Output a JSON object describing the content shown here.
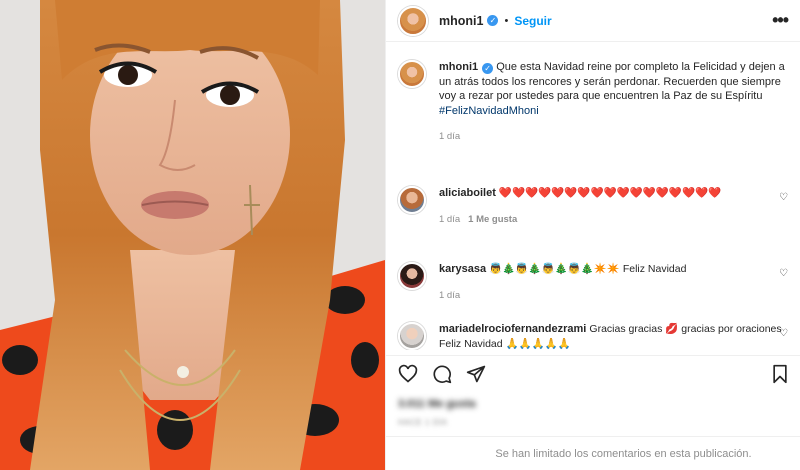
{
  "photo": {
    "alt_subject": "woman-portrait"
  },
  "header": {
    "username": "mhoni1",
    "follow_label": "Seguir",
    "more_label": "•••"
  },
  "caption": {
    "username": "mhoni1",
    "text": "Que esta Navidad reine por completo la Felicidad y dejen a un atrás todos los rencores y serán perdonar. Recuerden que siempre voy a rezar por ustedes para que encuentren la Paz de su Espíritu",
    "hashtag": "#FelizNavidadMhoni",
    "time": "1 día"
  },
  "comments": [
    {
      "username": "aliciaboilet",
      "text": "❤️❤️❤️❤️❤️❤️❤️❤️❤️❤️❤️❤️❤️❤️❤️❤️❤️",
      "time": "1 día",
      "likes": "1 Me gusta"
    },
    {
      "username": "karysasa",
      "text": "👼🎄👼🎄👼🎄👼🎄✴️✴️ Feliz Navidad",
      "time": "1 día",
      "likes": ""
    },
    {
      "username": "mariadelrociofernandezrami",
      "text": "Gracias gracias 💋 gracias por oraciones Feliz Navidad 🙏🙏🙏🙏🙏",
      "time": "",
      "likes": ""
    }
  ],
  "footer": {
    "likes_text": "3.011 Me gusta",
    "date_text": "HACE 1 DÍA",
    "limited_comments": "Se han limitado los comentarios en esta publicación."
  },
  "colors": {
    "accent": "#0095f6",
    "heart": "#ed4956",
    "muted": "#8e8e8e",
    "verified": "#3897f0"
  }
}
